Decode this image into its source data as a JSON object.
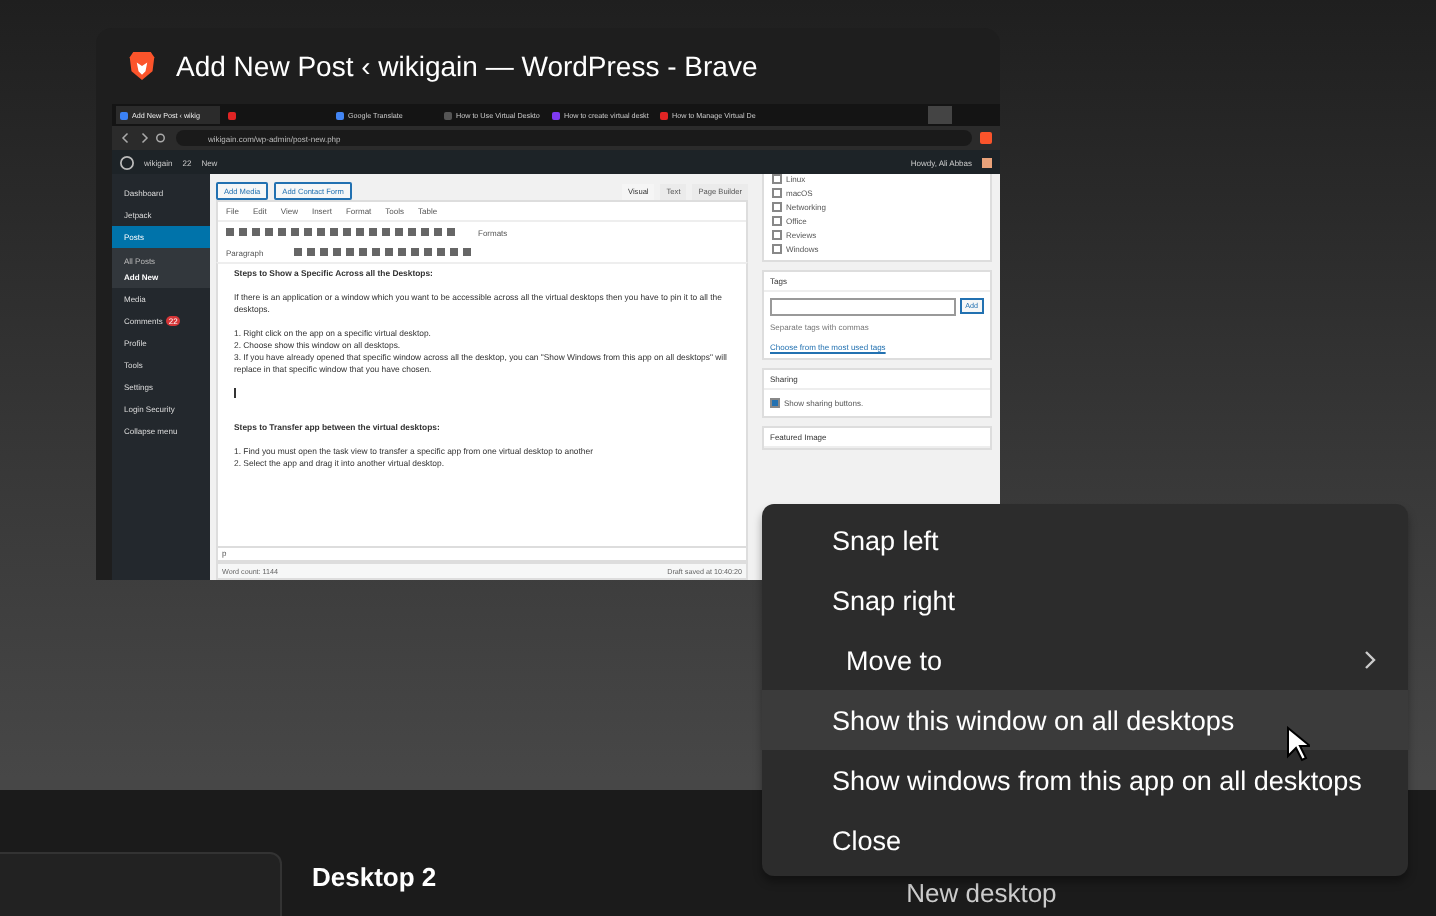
{
  "window": {
    "title": "Add New Post ‹ wikigain — WordPress - Brave"
  },
  "browser": {
    "tabs": [
      {
        "label": "Add New Post ‹ wikig",
        "selected": true,
        "color": "#3b82f6"
      },
      {
        "selected": false,
        "color": "#e02424"
      },
      {
        "label": "Google Translate",
        "selected": false,
        "color": "#4285f4"
      },
      {
        "label": "How to Use Virtual Deskto",
        "selected": false,
        "color": "#555555"
      },
      {
        "label": "How to create virtual deskt",
        "selected": false,
        "color": "#7e3af2"
      },
      {
        "label": "How to Manage Virtual De",
        "selected": false,
        "color": "#e02424"
      }
    ],
    "url": "wikigain.com/wp-admin/post-new.php"
  },
  "admin_bar": {
    "site": "wikigain",
    "comments": "22",
    "new": "New",
    "greeting": "Howdy, Ali Abbas"
  },
  "sidebar": {
    "items": [
      {
        "label": "Dashboard",
        "selected": false
      },
      {
        "label": "Jetpack",
        "selected": false
      },
      {
        "label": "Posts",
        "selected": true,
        "children": [
          {
            "label": "All Posts",
            "selected": false
          },
          {
            "label": "Add New",
            "selected": true
          }
        ]
      },
      {
        "label": "Media",
        "selected": false
      },
      {
        "label": "Comments",
        "badge": "22",
        "selected": false
      },
      {
        "label": "Profile",
        "selected": false
      },
      {
        "label": "Tools",
        "selected": false
      },
      {
        "label": "Settings",
        "selected": false
      },
      {
        "label": "Login Security",
        "selected": false
      },
      {
        "label": "Collapse menu",
        "selected": false
      }
    ]
  },
  "editor": {
    "media_buttons": [
      "Add Media",
      "Add Contact Form"
    ],
    "modes": [
      {
        "label": "Visual",
        "selected": true
      },
      {
        "label": "Text",
        "selected": false
      },
      {
        "label": "Page Builder",
        "selected": false
      }
    ],
    "menu": [
      "File",
      "Edit",
      "View",
      "Insert",
      "Format",
      "Tools",
      "Table"
    ],
    "formats": "Formats",
    "paragraph": "Paragraph",
    "content": [
      {
        "kind": "heading",
        "text": "Steps to Show a Specific Across all the Desktops:"
      },
      {
        "kind": "para",
        "text": "If there is an application or a window which you want to be accessible across all the virtual desktops then you have to pin it to all the desktops."
      },
      {
        "kind": "item",
        "text": "1. Right click on the app on a specific virtual desktop."
      },
      {
        "kind": "item",
        "text": "2. Choose show this window on all desktops."
      },
      {
        "kind": "item",
        "text": "3. If you have already opened that specific window across all the desktop, you can \"Show Windows from this app on all desktops\" will replace in that specific window that you have chosen."
      },
      {
        "kind": "caret"
      },
      {
        "kind": "heading",
        "text": "Steps to Transfer app between the virtual desktops:"
      },
      {
        "kind": "item",
        "text": "1. Find you must open the task view to transfer a specific app from one virtual desktop to another"
      },
      {
        "kind": "item",
        "text": "2. Select the app and drag it into another virtual desktop."
      }
    ],
    "path": "p",
    "word_count": "Word count: 1144",
    "draft": "Draft saved at 10:40:20"
  },
  "categories": [
    {
      "label": "Linux",
      "checked": false
    },
    {
      "label": "macOS",
      "checked": false
    },
    {
      "label": "Networking",
      "checked": false
    },
    {
      "label": "Office",
      "checked": false
    },
    {
      "label": "Reviews",
      "checked": false
    },
    {
      "label": "Windows",
      "checked": false
    }
  ],
  "tags": {
    "title": "Tags",
    "button": "Add",
    "hint": "Separate tags with commas",
    "link": "Choose from the most used tags"
  },
  "sharing": {
    "title": "Sharing",
    "label": "Show sharing buttons.",
    "checked": true
  },
  "featured": {
    "title": "Featured Image"
  },
  "context_menu": [
    {
      "label": "Snap left",
      "kind": "item",
      "selected": false
    },
    {
      "label": "Snap right",
      "kind": "item",
      "selected": false
    },
    {
      "label": "Move to",
      "kind": "submenu",
      "selected": false
    },
    {
      "label": "Show this window on all desktops",
      "kind": "item",
      "selected": true
    },
    {
      "label": "Show windows from this app on all desktops",
      "kind": "item",
      "selected": false
    },
    {
      "label": "Close",
      "kind": "item",
      "selected": false
    }
  ],
  "desktops": [
    {
      "selected": true
    },
    {
      "label": "Desktop 2",
      "selected": false
    }
  ],
  "new_desktop": "New desktop"
}
